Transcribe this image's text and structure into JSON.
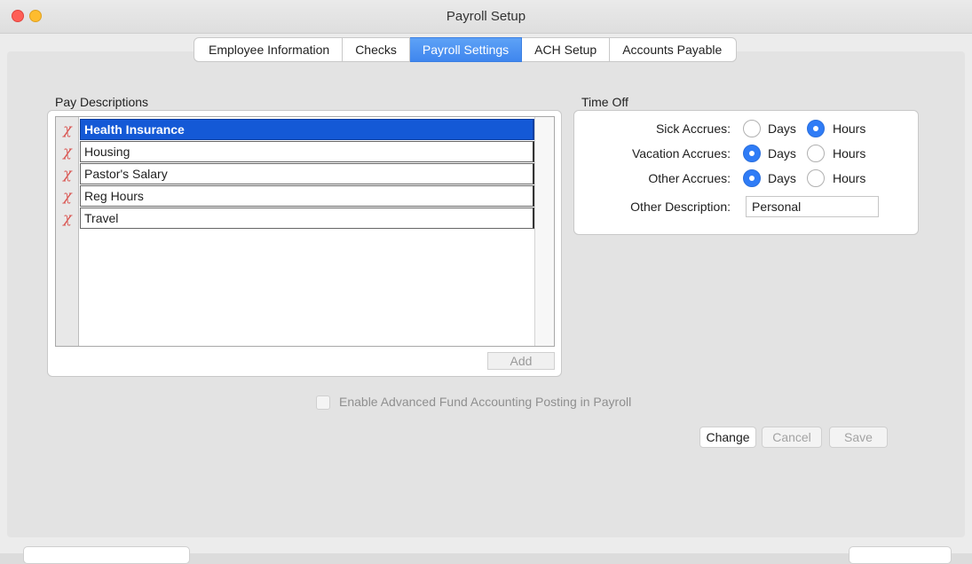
{
  "window": {
    "title": "Payroll Setup"
  },
  "tabs": [
    {
      "label": "Employee Information",
      "active": false
    },
    {
      "label": "Checks",
      "active": false
    },
    {
      "label": "Payroll Settings",
      "active": true
    },
    {
      "label": "ACH Setup",
      "active": false
    },
    {
      "label": "Accounts Payable",
      "active": false
    }
  ],
  "pay_descriptions": {
    "label": "Pay Descriptions",
    "items": [
      {
        "label": "Health Insurance",
        "selected": true
      },
      {
        "label": "Housing",
        "selected": false
      },
      {
        "label": "Pastor's Salary",
        "selected": false
      },
      {
        "label": "Reg Hours",
        "selected": false
      },
      {
        "label": "Travel",
        "selected": false
      }
    ],
    "delete_icon": "remove-x-icon",
    "add_label": "Add"
  },
  "time_off": {
    "label": "Time Off",
    "rows": [
      {
        "label": "Sick Accrues:",
        "days_label": "Days",
        "hours_label": "Hours",
        "selected": "Hours"
      },
      {
        "label": "Vacation Accrues:",
        "days_label": "Days",
        "hours_label": "Hours",
        "selected": "Days"
      },
      {
        "label": "Other Accrues:",
        "days_label": "Days",
        "hours_label": "Hours",
        "selected": "Days"
      }
    ],
    "other_description_label": "Other Description:",
    "other_description_value": "Personal"
  },
  "fund_accounting": {
    "label": "Enable Advanced Fund Accounting Posting in Payroll",
    "checked": false,
    "enabled": false
  },
  "actions": {
    "change_label": "Change",
    "cancel_label": "Cancel",
    "save_label": "Save"
  },
  "colors": {
    "accent": "#2f7cf6",
    "selection": "#1459d6",
    "close": "#fe5f57",
    "minimize": "#febc2e"
  }
}
